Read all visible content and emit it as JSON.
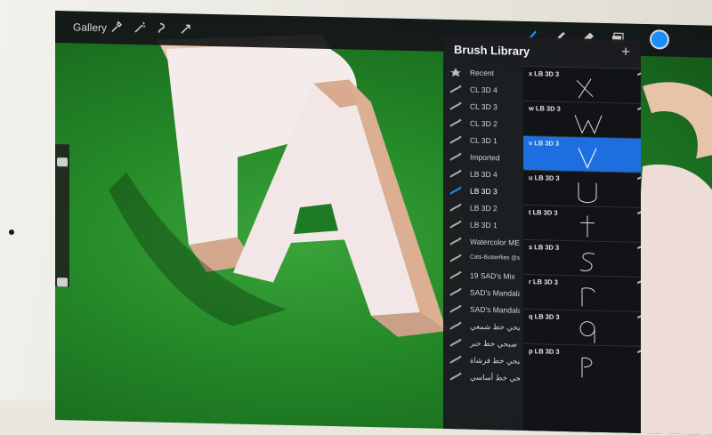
{
  "toolbar": {
    "gallery_label": "Gallery",
    "icons": [
      "wrench-icon",
      "magic-wand-icon",
      "selection-icon",
      "transform-arrow-icon",
      "brush-icon",
      "smudge-icon",
      "eraser-icon",
      "layers-icon",
      "color-swatch-icon"
    ],
    "accent_color": "#1d8cf8"
  },
  "brush_library": {
    "title": "Brush Library",
    "add_label": "+",
    "sets": [
      {
        "label": "Recent",
        "icon": "star-icon"
      },
      {
        "label": "CL 3D 4",
        "icon": "brush-stroke-icon"
      },
      {
        "label": "CL 3D 3",
        "icon": "brush-stroke-icon"
      },
      {
        "label": "CL 3D 2",
        "icon": "brush-stroke-icon"
      },
      {
        "label": "CL 3D 1",
        "icon": "brush-stroke-icon"
      },
      {
        "label": "Imported",
        "icon": "brush-stroke-icon"
      },
      {
        "label": "LB 3D 4",
        "icon": "brush-stroke-icon"
      },
      {
        "label": "LB 3D 3",
        "icon": "brush-stroke-icon",
        "active": true
      },
      {
        "label": "LB 3D 2",
        "icon": "brush-stroke-icon"
      },
      {
        "label": "LB 3D 1",
        "icon": "brush-stroke-icon"
      },
      {
        "label": "Watercolor ME",
        "icon": "brush-stroke-icon"
      },
      {
        "label": "Cats-Butterflies @su...",
        "icon": "brush-stroke-icon"
      },
      {
        "label": "19 SAD's Mix",
        "icon": "brush-stroke-icon"
      },
      {
        "label": "SAD's Mandala Pa",
        "icon": "brush-stroke-icon"
      },
      {
        "label": "SAD's Mandala Fr",
        "icon": "brush-stroke-icon"
      },
      {
        "label": "صبحي خط شمعي",
        "icon": "brush-stroke-icon"
      },
      {
        "label": "صبحي خط حبر",
        "icon": "brush-stroke-icon"
      },
      {
        "label": "صبحي خط فرشاة",
        "icon": "brush-stroke-icon"
      },
      {
        "label": "صبحي خط أساسي",
        "icon": "brush-stroke-icon"
      }
    ],
    "brushes": [
      {
        "name": "x LB 3D 3"
      },
      {
        "name": "w LB 3D 3"
      },
      {
        "name": "v LB 3D 3",
        "selected": true
      },
      {
        "name": "u LB 3D 3"
      },
      {
        "name": "t LB 3D 3"
      },
      {
        "name": "s LB 3D 3"
      },
      {
        "name": "r LB 3D 3"
      },
      {
        "name": "q LB 3D 3"
      },
      {
        "name": "p LB 3D 3"
      }
    ],
    "selected_color": "#1d6fe0"
  }
}
